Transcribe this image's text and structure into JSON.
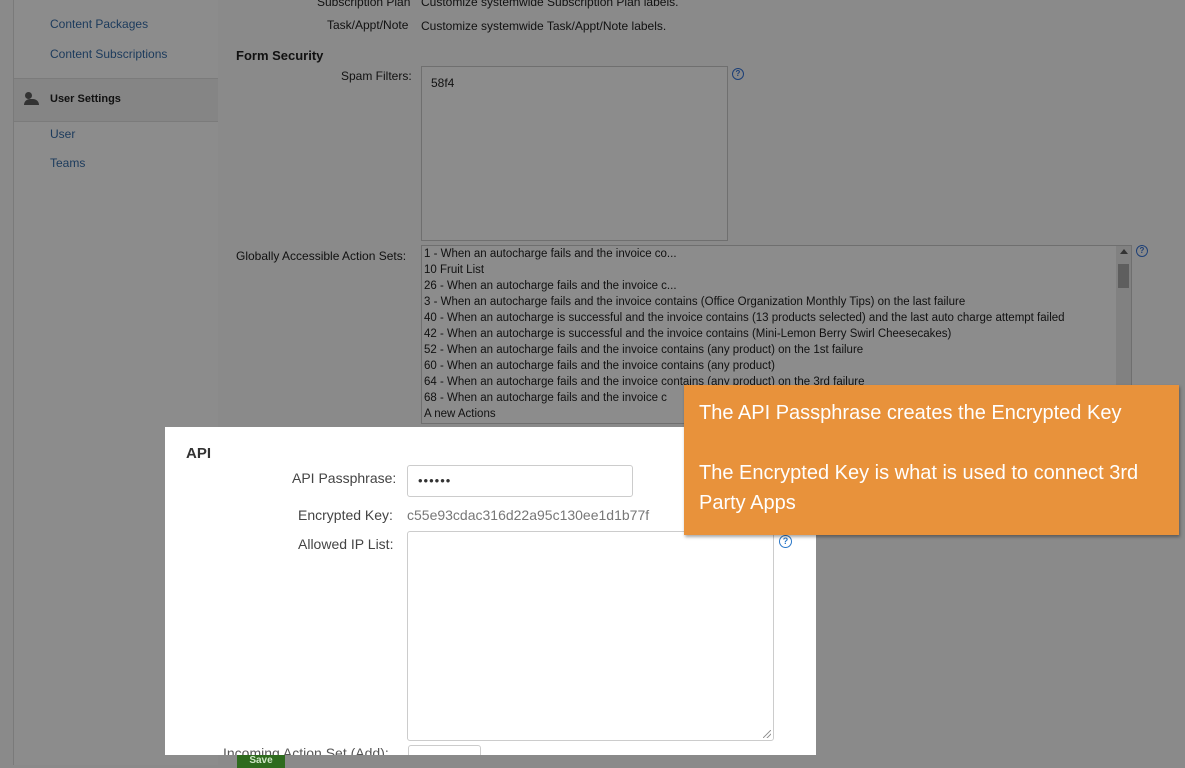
{
  "sidebar": {
    "links_top": [
      "Content Packages",
      "Content Subscriptions"
    ],
    "section_title": "User Settings",
    "section_icon": "users-icon",
    "links_bottom": [
      "User",
      "Teams"
    ]
  },
  "labels_rows": [
    {
      "label": "Subscription Plan",
      "desc": "Customize systemwide Subscription Plan labels."
    },
    {
      "label": "Task/Appt/Note",
      "desc": "Customize systemwide Task/Appt/Note labels."
    }
  ],
  "form_security": {
    "heading": "Form Security",
    "spam_label": "Spam Filters:",
    "spam_value": "58f4",
    "actions_label": "Globally Accessible Action Sets:",
    "action_sets": [
      "1 - When an autocharge fails and the invoice co...",
      "10 Fruit List",
      "26 - When an autocharge fails and the invoice c...",
      "3 - When an autocharge fails and the invoice contains (Office Organization Monthly Tips) on the last failure",
      "40 - When an autocharge is successful and the invoice contains (13 products selected) and the last auto charge attempt failed",
      "42 - When an autocharge is successful and the invoice contains (Mini-Lemon Berry Swirl Cheesecakes)",
      "52 - When an autocharge fails and the invoice contains (any product) on the 1st failure",
      "60 - When an autocharge fails and the invoice contains (any product)",
      "64 - When an autocharge fails and the invoice contains (any product) on the 3rd failure",
      "68 - When an autocharge fails and the invoice c",
      "A new Actions"
    ],
    "help_glyph": "?"
  },
  "save_label": "Save",
  "api": {
    "title": "API",
    "passphrase_label": "API Passphrase:",
    "passphrase_value": "••••••",
    "encrypted_label": "Encrypted Key:",
    "encrypted_value": "c55e93cdac316d22a95c130ee1d1b77f",
    "ip_label": "Allowed IP List:",
    "incoming_label": "Incoming Action Set (Add):",
    "help_glyph": "?"
  },
  "callout": {
    "line1": "The API Passphrase creates the Encrypted Key",
    "line2": "The Encrypted Key is what is used to connect 3rd Party Apps"
  },
  "colors": {
    "callout_bg": "#e8923b",
    "overlay_bg": "#8a8a8a",
    "save_green": "#2e6b1e",
    "help_blue": "#2b78c8"
  }
}
